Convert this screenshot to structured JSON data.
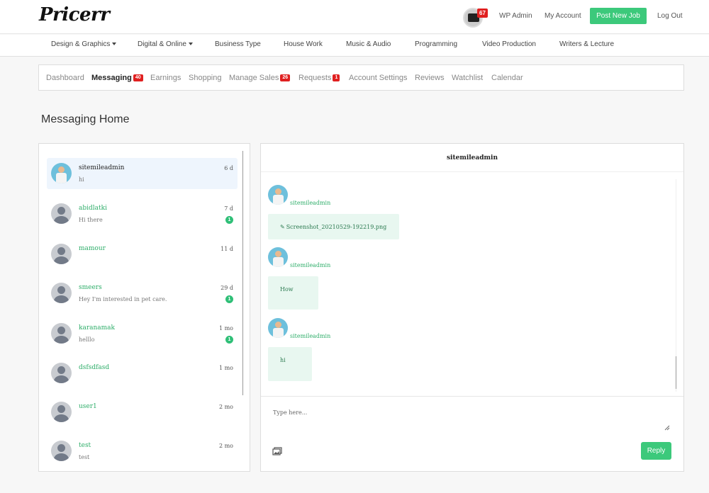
{
  "header": {
    "logo": "Pricerr",
    "notification_count": "67",
    "links": {
      "wp_admin": "WP Admin",
      "my_account": "My Account",
      "post_job": "Post New Job",
      "logout": "Log Out"
    }
  },
  "categories": [
    "Design & Graphics",
    "Digital & Online",
    "Business Type",
    "House Work",
    "Music & Audio",
    "Programming",
    "Video Production",
    "Writers & Lecture"
  ],
  "tabs": [
    {
      "label": "Dashboard"
    },
    {
      "label": "Messaging",
      "badge": "40"
    },
    {
      "label": "Earnings"
    },
    {
      "label": "Shopping"
    },
    {
      "label": "Manage Sales",
      "badge": "26"
    },
    {
      "label": "Requests",
      "badge": "1"
    },
    {
      "label": "Account Settings"
    },
    {
      "label": "Reviews"
    },
    {
      "label": "Watchlist"
    },
    {
      "label": "Calendar"
    }
  ],
  "page_title": "Messaging Home",
  "conversations": [
    {
      "name": "sitemileadmin",
      "preview": "hi",
      "time": "6 d",
      "unread": ""
    },
    {
      "name": "abidlatki",
      "preview": "Hi there",
      "time": "7 d",
      "unread": "1"
    },
    {
      "name": "mamour",
      "preview": "",
      "time": "11 d",
      "unread": ""
    },
    {
      "name": "smeers",
      "preview": "Hey I'm interested in pet care.",
      "time": "29 d",
      "unread": "1"
    },
    {
      "name": "karanamak",
      "preview": "helllo",
      "time": "1 mo",
      "unread": "1"
    },
    {
      "name": "dsfsdfasd",
      "preview": "",
      "time": "1 mo",
      "unread": ""
    },
    {
      "name": "user1",
      "preview": "",
      "time": "2 mo",
      "unread": ""
    },
    {
      "name": "test",
      "preview": "test",
      "time": "2 mo",
      "unread": ""
    }
  ],
  "chat": {
    "title": "sitemileadmin",
    "messages": [
      {
        "author": "sitemileadmin",
        "text": "Screenshot_20210529-192219.png"
      },
      {
        "author": "sitemileadmin",
        "text": "How"
      },
      {
        "author": "sitemileadmin",
        "text": "hi"
      }
    ],
    "placeholder": "Type here...",
    "reply_label": "Reply"
  },
  "colors": {
    "accent": "#3cc97b",
    "badge": "#e02020",
    "link_green": "#2fae6a"
  }
}
